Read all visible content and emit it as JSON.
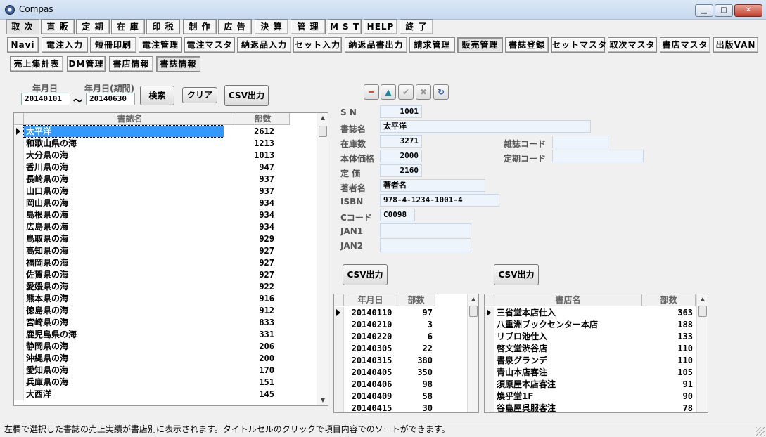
{
  "window": {
    "title": "Compas",
    "min": "▁",
    "max": "□",
    "close": "✕",
    "icon": "compass-icon"
  },
  "menu_row1": [
    "取 次",
    "直 販",
    "定 期",
    "在 庫",
    "印 税",
    "制 作",
    "広 告",
    "決 算",
    "管 理",
    "M S T",
    "HELP",
    "終 了"
  ],
  "menu_row2": [
    "Navi",
    "電注入力",
    "短冊印刷",
    "電注管理",
    "電注マスタ",
    "納返品入力",
    "セット入力",
    "納返品書出力",
    "請求管理",
    "販売管理",
    "書誌登録",
    "セットマスタ",
    "取次マスタ",
    "書店マスタ",
    "出版VAN"
  ],
  "menu_row3": [
    "売上集計表",
    "DM管理",
    "書店情報",
    "書誌情報"
  ],
  "search": {
    "date_label": "年月日",
    "date_from": "20140101",
    "tilde": "～",
    "period_label": "年月日(期間)",
    "date_to": "20140630",
    "search_btn": "検索",
    "clear_btn": "クリア",
    "csv_btn": "CSV出力"
  },
  "nav_icons": [
    "minus-icon",
    "triangle-up-icon",
    "check-icon",
    "cross-icon",
    "refresh-icon"
  ],
  "nav_glyphs": [
    "━",
    "▲",
    "✔",
    "✖",
    "↻"
  ],
  "left_grid": {
    "headers": [
      "書誌名",
      "部数"
    ],
    "rows": [
      [
        "太平洋",
        "2612"
      ],
      [
        "和歌山県の海",
        "1213"
      ],
      [
        "大分県の海",
        "1013"
      ],
      [
        "香川県の海",
        "947"
      ],
      [
        "長崎県の海",
        "937"
      ],
      [
        "山口県の海",
        "937"
      ],
      [
        "岡山県の海",
        "934"
      ],
      [
        "島根県の海",
        "934"
      ],
      [
        "広島県の海",
        "934"
      ],
      [
        "鳥取県の海",
        "929"
      ],
      [
        "高知県の海",
        "927"
      ],
      [
        "福岡県の海",
        "927"
      ],
      [
        "佐賀県の海",
        "927"
      ],
      [
        "愛媛県の海",
        "922"
      ],
      [
        "熊本県の海",
        "916"
      ],
      [
        "徳島県の海",
        "912"
      ],
      [
        "宮崎県の海",
        "833"
      ],
      [
        "鹿児島県の海",
        "331"
      ],
      [
        "静岡県の海",
        "206"
      ],
      [
        "沖縄県の海",
        "200"
      ],
      [
        "愛知県の海",
        "170"
      ],
      [
        "兵庫県の海",
        "151"
      ],
      [
        "大西洋",
        "145"
      ]
    ]
  },
  "detail": {
    "sn_label": "S N",
    "sn": "1001",
    "title_label": "書誌名",
    "title": "太平洋",
    "stock_label": "在庫数",
    "stock": "3271",
    "magazine_label": "雑誌コード",
    "magazine": "",
    "price_label": "本体価格",
    "price": "2000",
    "regular_label": "定期コード",
    "regular": "",
    "list_label": "定 価",
    "list_price": "2160",
    "author_label": "著者名",
    "author": "著者名",
    "isbn_label": "ISBN",
    "isbn": "978-4-1234-1001-4",
    "ccode_label": "Cコード",
    "ccode": "C0098",
    "jan1_label": "JAN1",
    "jan1": "",
    "jan2_label": "JAN2",
    "jan2": ""
  },
  "csv_btn_mid": "CSV出力",
  "csv_btn_right": "CSV出力",
  "date_grid": {
    "headers": [
      "年月日",
      "部数"
    ],
    "rows": [
      [
        "20140110",
        "97"
      ],
      [
        "20140210",
        "3"
      ],
      [
        "20140220",
        "6"
      ],
      [
        "20140305",
        "22"
      ],
      [
        "20140315",
        "380"
      ],
      [
        "20140405",
        "350"
      ],
      [
        "20140406",
        "98"
      ],
      [
        "20140409",
        "58"
      ],
      [
        "20140415",
        "30"
      ]
    ]
  },
  "store_grid": {
    "headers": [
      "書店名",
      "部数"
    ],
    "rows": [
      [
        "三省堂本店仕入",
        "363"
      ],
      [
        "八重洲ブックセンター本店",
        "188"
      ],
      [
        "リブロ池仕入",
        "133"
      ],
      [
        "啓文堂渋谷店",
        "110"
      ],
      [
        "書泉グランデ",
        "110"
      ],
      [
        "青山本店客注",
        "105"
      ],
      [
        "須原屋本店客注",
        "91"
      ],
      [
        "煥乎堂1F",
        "90"
      ],
      [
        "谷島屋呉服客注",
        "78"
      ]
    ]
  },
  "status": "左欄で選択した書誌の売上実績が書店別に表示されます。タイトルセルのクリックで項目内容でのソートができます。"
}
